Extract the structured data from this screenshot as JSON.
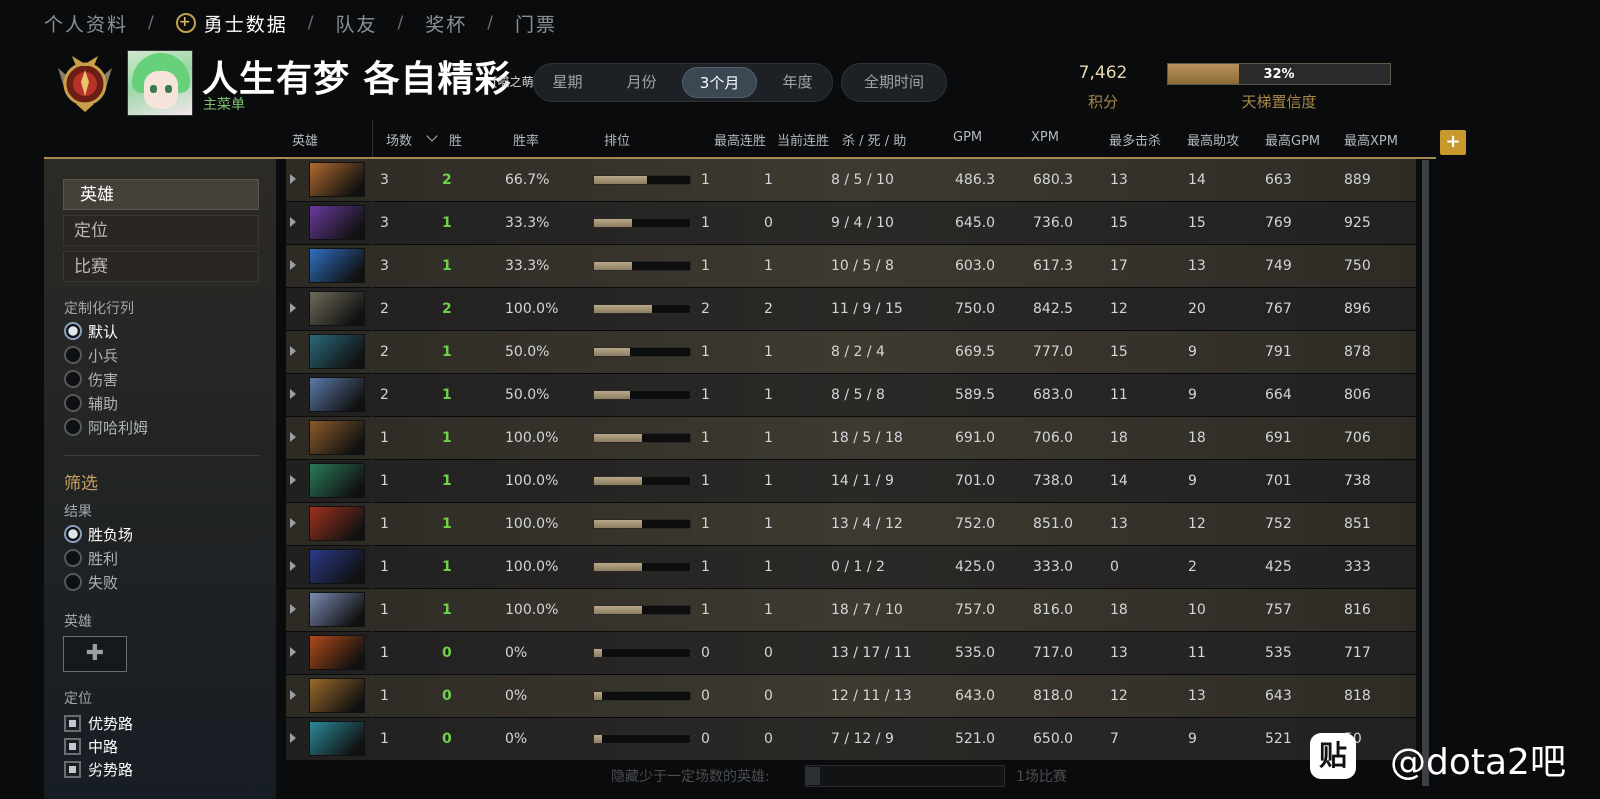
{
  "topnav": {
    "items": [
      "个人资料",
      "勇士数据",
      "队友",
      "奖杯",
      "门票"
    ],
    "separator": "/",
    "active_index": 1
  },
  "header": {
    "player_name": "人生有梦 各自精彩",
    "player_tag": "[喵之萌杀♥",
    "subtitle": "主菜单",
    "periods": [
      "星期",
      "月份",
      "3个月",
      "年度"
    ],
    "active_period": "3个月",
    "all_time": "全期时间",
    "score_value": "7,462",
    "score_label": "积分",
    "confidence_value": "32%",
    "confidence_fraction": 0.32,
    "confidence_label": "天梯置信度"
  },
  "columns": {
    "hero": "英雄",
    "matches": "场数",
    "wins": "胜",
    "winrate": "胜率",
    "rank": "排位",
    "max_streak": "最高连胜",
    "cur_streak": "当前连胜",
    "kda": "杀 / 死 / 助",
    "gpm": "GPM",
    "xpm": "XPM",
    "max_kills": "最多击杀",
    "max_assists": "最高助攻",
    "max_gpm": "最高GPM",
    "max_xpm": "最高XPM",
    "add_button": "+"
  },
  "sidebar": {
    "tabs": [
      "英雄",
      "定位",
      "比赛"
    ],
    "active_tab": "英雄",
    "custom_columns_label": "定制化行列",
    "custom_columns_options": [
      "默认",
      "小兵",
      "伤害",
      "辅助",
      "阿哈利姆"
    ],
    "custom_columns_selected": "默认",
    "filter_label": "筛选",
    "result_label": "结果",
    "result_options": [
      "胜负场",
      "胜利",
      "失败"
    ],
    "result_selected": "胜负场",
    "hero_label": "英雄",
    "hero_add": "✚",
    "role_label": "定位",
    "role_options": [
      "优势路",
      "中路",
      "劣势路"
    ]
  },
  "rows": [
    {
      "matches": "3",
      "wins": "2",
      "winrate": "66.7%",
      "rank_fraction": 0.55,
      "max_streak": "1",
      "cur_streak": "1",
      "kda": "8 / 5 / 10",
      "gpm": "486.3",
      "xpm": "680.3",
      "max_kills": "13",
      "max_assists": "14",
      "max_gpm": "663",
      "max_xpm": "889",
      "hero_color": "#b06a2e"
    },
    {
      "matches": "3",
      "wins": "1",
      "winrate": "33.3%",
      "rank_fraction": 0.4,
      "max_streak": "1",
      "cur_streak": "0",
      "kda": "9 / 4 / 10",
      "gpm": "645.0",
      "xpm": "736.0",
      "max_kills": "15",
      "max_assists": "15",
      "max_gpm": "769",
      "max_xpm": "925",
      "hero_color": "#6a3aa0"
    },
    {
      "matches": "3",
      "wins": "1",
      "winrate": "33.3%",
      "rank_fraction": 0.4,
      "max_streak": "1",
      "cur_streak": "1",
      "kda": "10 / 5 / 8",
      "gpm": "603.0",
      "xpm": "617.3",
      "max_kills": "17",
      "max_assists": "13",
      "max_gpm": "749",
      "max_xpm": "750",
      "hero_color": "#2f6fc4"
    },
    {
      "matches": "2",
      "wins": "2",
      "winrate": "100.0%",
      "rank_fraction": 0.6,
      "max_streak": "2",
      "cur_streak": "2",
      "kda": "11 / 9 / 15",
      "gpm": "750.0",
      "xpm": "842.5",
      "max_kills": "12",
      "max_assists": "20",
      "max_gpm": "767",
      "max_xpm": "896",
      "hero_color": "#6e6a5a"
    },
    {
      "matches": "2",
      "wins": "1",
      "winrate": "50.0%",
      "rank_fraction": 0.38,
      "max_streak": "1",
      "cur_streak": "1",
      "kda": "8 / 2 / 4",
      "gpm": "669.5",
      "xpm": "777.0",
      "max_kills": "15",
      "max_assists": "9",
      "max_gpm": "791",
      "max_xpm": "878",
      "hero_color": "#2a6a7a"
    },
    {
      "matches": "2",
      "wins": "1",
      "winrate": "50.0%",
      "rank_fraction": 0.38,
      "max_streak": "1",
      "cur_streak": "1",
      "kda": "8 / 5 / 8",
      "gpm": "589.5",
      "xpm": "683.0",
      "max_kills": "11",
      "max_assists": "9",
      "max_gpm": "664",
      "max_xpm": "806",
      "hero_color": "#5a7aa8"
    },
    {
      "matches": "1",
      "wins": "1",
      "winrate": "100.0%",
      "rank_fraction": 0.5,
      "max_streak": "1",
      "cur_streak": "1",
      "kda": "18 / 5 / 18",
      "gpm": "691.0",
      "xpm": "706.0",
      "max_kills": "18",
      "max_assists": "18",
      "max_gpm": "691",
      "max_xpm": "706",
      "hero_color": "#8a5a2a"
    },
    {
      "matches": "1",
      "wins": "1",
      "winrate": "100.0%",
      "rank_fraction": 0.5,
      "max_streak": "1",
      "cur_streak": "1",
      "kda": "14 / 1 / 9",
      "gpm": "701.0",
      "xpm": "738.0",
      "max_kills": "14",
      "max_assists": "9",
      "max_gpm": "701",
      "max_xpm": "738",
      "hero_color": "#2a7a5a"
    },
    {
      "matches": "1",
      "wins": "1",
      "winrate": "100.0%",
      "rank_fraction": 0.5,
      "max_streak": "1",
      "cur_streak": "1",
      "kda": "13 / 4 / 12",
      "gpm": "752.0",
      "xpm": "851.0",
      "max_kills": "13",
      "max_assists": "12",
      "max_gpm": "752",
      "max_xpm": "851",
      "hero_color": "#a0321e"
    },
    {
      "matches": "1",
      "wins": "1",
      "winrate": "100.0%",
      "rank_fraction": 0.5,
      "max_streak": "1",
      "cur_streak": "1",
      "kda": "0 / 1 / 2",
      "gpm": "425.0",
      "xpm": "333.0",
      "max_kills": "0",
      "max_assists": "2",
      "max_gpm": "425",
      "max_xpm": "333",
      "hero_color": "#2a3a8a"
    },
    {
      "matches": "1",
      "wins": "1",
      "winrate": "100.0%",
      "rank_fraction": 0.5,
      "max_streak": "1",
      "cur_streak": "1",
      "kda": "18 / 7 / 10",
      "gpm": "757.0",
      "xpm": "816.0",
      "max_kills": "18",
      "max_assists": "10",
      "max_gpm": "757",
      "max_xpm": "816",
      "hero_color": "#7a8ab0"
    },
    {
      "matches": "1",
      "wins": "0",
      "winrate": "0%",
      "rank_fraction": 0.08,
      "max_streak": "0",
      "cur_streak": "0",
      "kda": "13 / 17 / 11",
      "gpm": "535.0",
      "xpm": "717.0",
      "max_kills": "13",
      "max_assists": "11",
      "max_gpm": "535",
      "max_xpm": "717",
      "hero_color": "#b04a1a"
    },
    {
      "matches": "1",
      "wins": "0",
      "winrate": "0%",
      "rank_fraction": 0.08,
      "max_streak": "0",
      "cur_streak": "0",
      "kda": "12 / 11 / 13",
      "gpm": "643.0",
      "xpm": "818.0",
      "max_kills": "12",
      "max_assists": "13",
      "max_gpm": "643",
      "max_xpm": "818",
      "hero_color": "#9a6a2a"
    },
    {
      "matches": "1",
      "wins": "0",
      "winrate": "0%",
      "rank_fraction": 0.08,
      "max_streak": "0",
      "cur_streak": "0",
      "kda": "7 / 12 / 9",
      "gpm": "521.0",
      "xpm": "650.0",
      "max_kills": "7",
      "max_assists": "9",
      "max_gpm": "521",
      "max_xpm": "50",
      "hero_color": "#2a8a9a"
    }
  ],
  "bottom": {
    "filter_label": "隐藏少于一定场数的英雄:",
    "filter_value": "1场比赛"
  },
  "watermark": {
    "icon": "贴",
    "text": "@dota2吧"
  }
}
